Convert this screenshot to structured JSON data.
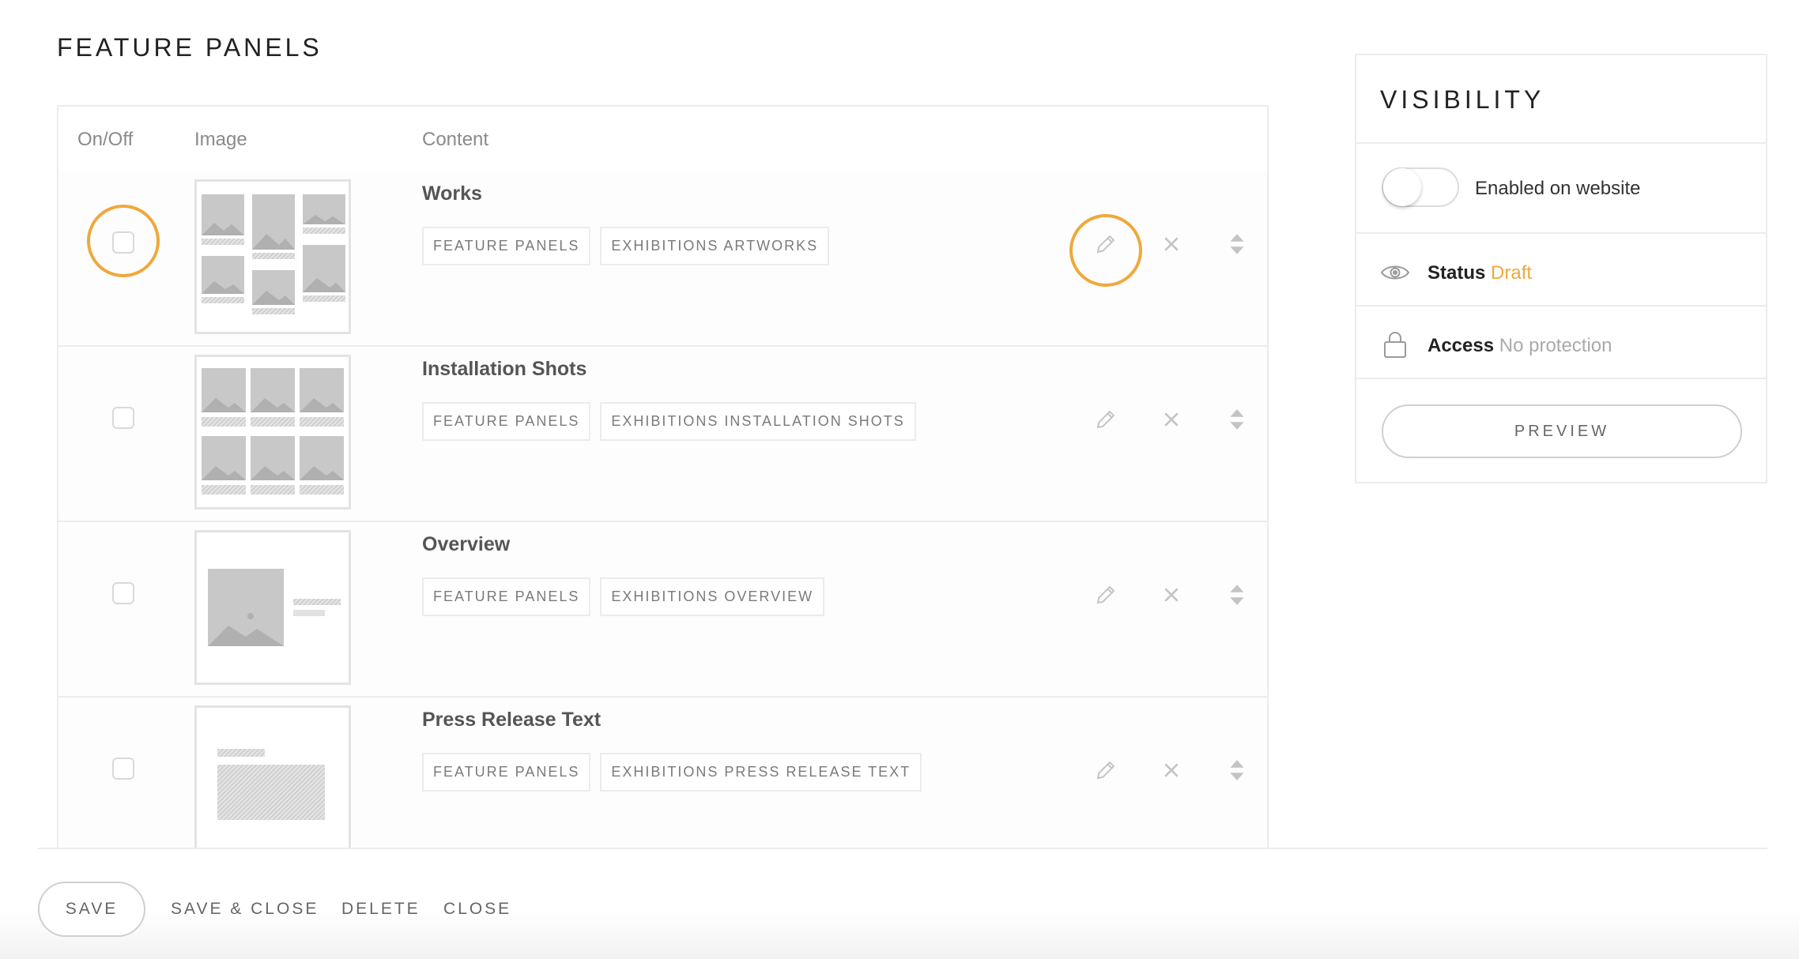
{
  "page": {
    "title": "FEATURE PANELS"
  },
  "table": {
    "columns": {
      "onoff": "On/Off",
      "image": "Image",
      "content": "Content"
    },
    "rows": [
      {
        "title": "Works",
        "tags": [
          "FEATURE PANELS",
          "EXHIBITIONS ARTWORKS"
        ],
        "checked": false,
        "thumb": "grid-artworks"
      },
      {
        "title": "Installation Shots",
        "tags": [
          "FEATURE PANELS",
          "EXHIBITIONS INSTALLATION SHOTS"
        ],
        "checked": false,
        "thumb": "grid-installation"
      },
      {
        "title": "Overview",
        "tags": [
          "FEATURE PANELS",
          "EXHIBITIONS OVERVIEW"
        ],
        "checked": false,
        "thumb": "image-text"
      },
      {
        "title": "Press Release Text",
        "tags": [
          "FEATURE PANELS",
          "EXHIBITIONS PRESS RELEASE TEXT"
        ],
        "checked": false,
        "thumb": "text-block"
      }
    ],
    "row_icons": [
      "pencil-icon",
      "close-icon",
      "sort-arrows-icon"
    ]
  },
  "visibility": {
    "title": "VISIBILITY",
    "toggle_label": "Enabled on website",
    "toggle_on": false,
    "status_label": "Status",
    "status_value": "Draft",
    "access_label": "Access",
    "access_value": "No protection",
    "preview_label": "PREVIEW"
  },
  "footer": {
    "save": "SAVE",
    "save_close": "SAVE & CLOSE",
    "delete": "DELETE",
    "close": "CLOSE"
  },
  "colors": {
    "accent": "#f0a83c",
    "border": "#ececec",
    "text": "#555555",
    "placeholder": "#c8c8c8"
  }
}
